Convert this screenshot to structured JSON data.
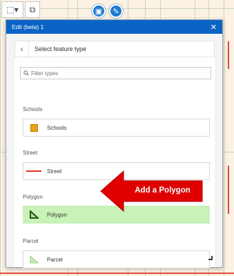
{
  "dialog": {
    "title": "Edit (beta) 1",
    "close_icon": "close-icon",
    "nav_title": "Select feature type",
    "filter_placeholder": "Filter types"
  },
  "groups": [
    {
      "label": "Schools",
      "item": "Schools",
      "symbol": "square-orange",
      "color": "#e8a317"
    },
    {
      "label": "Street",
      "item": "Street",
      "symbol": "line-red",
      "color": "#e0321f"
    },
    {
      "label": "Polygon",
      "item": "Polygon",
      "symbol": "polygon-green",
      "color": "#2b6b1a"
    },
    {
      "label": "Parcel",
      "item": "Parcel",
      "symbol": "polygon-lightgreen",
      "color": "#bfe8a8"
    }
  ],
  "annotation": {
    "text": "Add a Polygon",
    "color": "#e10000"
  },
  "colors": {
    "header": "#0b64c5",
    "selected": "#c8f2b8"
  }
}
